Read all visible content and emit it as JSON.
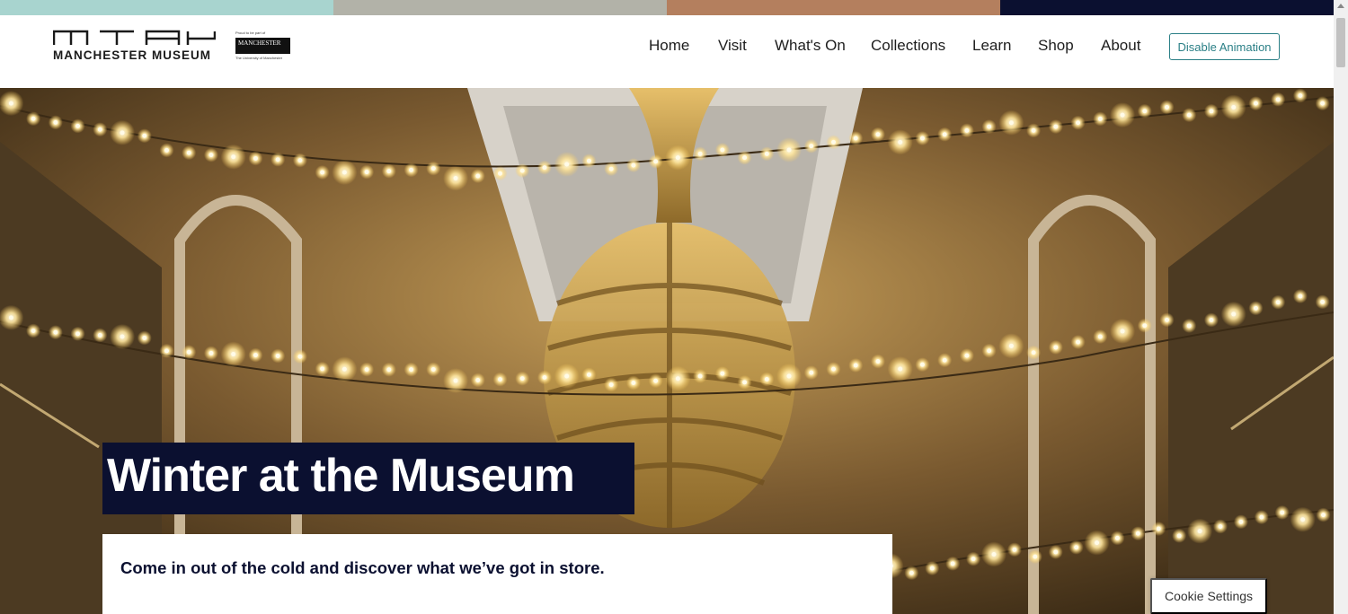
{
  "brand": {
    "logo_text": "MANCHESTER MUSEUM",
    "partner_line": "Proud to be part of",
    "partner_name": "MANCHESTER",
    "partner_sub": "The University of Manchester",
    "colorbar_colors": [
      "#a8d4cf",
      "#b2b2a8",
      "#b47f5e",
      "#0b1030"
    ]
  },
  "nav": {
    "items": [
      "Home",
      "Visit",
      "What's On",
      "Collections",
      "Learn",
      "Shop",
      "About"
    ],
    "animation_button": "Disable Animation"
  },
  "hero": {
    "title": "Winter at the Museum",
    "subtitle": "Come in out of the cold and discover what we’ve got in store.",
    "image_icon": "whale-skeleton-with-fairy-lights"
  },
  "cookie": {
    "label": "Cookie Settings"
  },
  "colors": {
    "title_bg": "#0b1030",
    "button_accent": "#2a7f86"
  }
}
